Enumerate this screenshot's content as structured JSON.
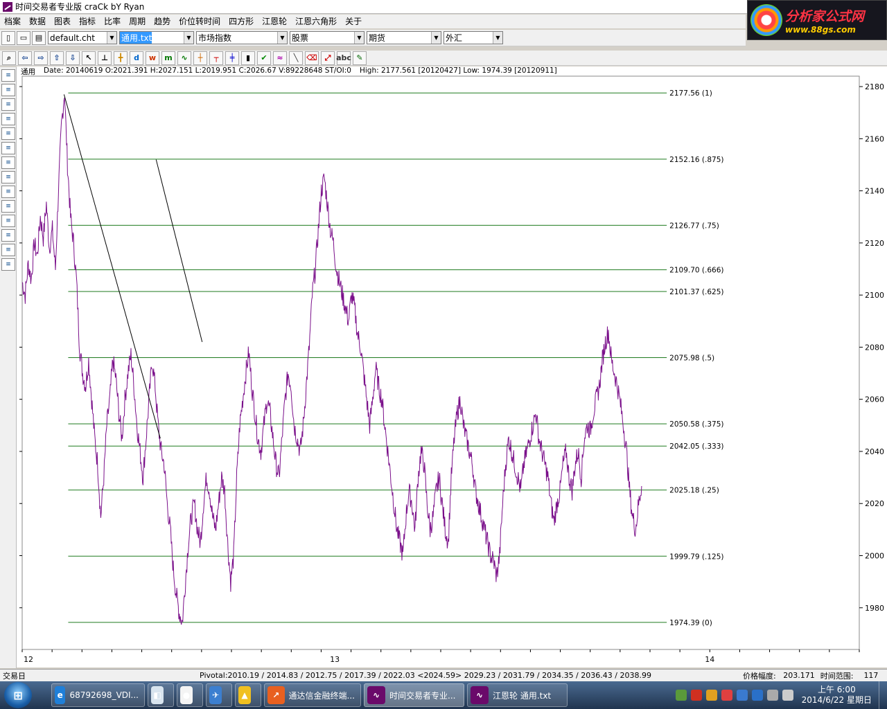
{
  "window": {
    "title": "时间交易者专业版 craCk bY Ryan"
  },
  "ad": {
    "main": "分析家公式网",
    "url": "www.88gs.com"
  },
  "menu": [
    "档案",
    "数据",
    "图表",
    "指标",
    "比率",
    "周期",
    "趋势",
    "价位转时间",
    "四方形",
    "江恩轮",
    "江恩六角形",
    "关于"
  ],
  "toolbar": {
    "combos": [
      {
        "value": "default.cht",
        "w": 100,
        "selected": false
      },
      {
        "value": "通用.txt",
        "w": 108,
        "selected": true
      },
      {
        "value": "市场指数",
        "w": 132,
        "selected": false
      },
      {
        "value": "股票",
        "w": 108,
        "selected": false
      },
      {
        "value": "期货",
        "w": 108,
        "selected": false
      },
      {
        "value": "外汇",
        "w": 86,
        "selected": false
      }
    ]
  },
  "info": {
    "symbol": "通用",
    "ohlc": "Date: 20140619 O:2021.391  H:2027.151  L:2019.951  C:2026.67  V:89228648 ST/OI:0",
    "range": "High: 2177.561 [20120427]  Low: 1974.39 [20120911]"
  },
  "chart_data": {
    "type": "line",
    "y_axis_ticks": [
      1980,
      2000,
      2020,
      2040,
      2060,
      2080,
      2100,
      2120,
      2140,
      2160,
      2180
    ],
    "ylim": [
      1964,
      2184
    ],
    "x_labels": [
      {
        "label": "12",
        "pos": 0.0
      },
      {
        "label": "13",
        "pos": 0.366
      },
      {
        "label": "14",
        "pos": 0.814
      }
    ],
    "fib_levels": [
      {
        "value": 2177.56,
        "label": "2177.56  (1)"
      },
      {
        "value": 2152.16,
        "label": "2152.16  (.875)"
      },
      {
        "value": 2126.77,
        "label": "2126.77  (.75)"
      },
      {
        "value": 2109.7,
        "label": "2109.70  (.666)"
      },
      {
        "value": 2101.37,
        "label": "2101.37  (.625)"
      },
      {
        "value": 2075.98,
        "label": "2075.98  (.5)"
      },
      {
        "value": 2050.58,
        "label": "2050.58  (.375)"
      },
      {
        "value": 2042.05,
        "label": "2042.05  (.333)"
      },
      {
        "value": 2025.18,
        "label": "2025.18  (.25)"
      },
      {
        "value": 1999.79,
        "label": "1999.79  (.125)"
      },
      {
        "value": 1974.39,
        "label": "1974.39  (0)"
      }
    ],
    "series": [
      {
        "values": [
          2105,
          2100,
          2112,
          2106,
          2120,
          2115,
          2130,
          2122,
          2135,
          2118,
          2125,
          2110,
          2140,
          2165,
          2178,
          2150,
          2130,
          2120,
          2105,
          2080,
          2070,
          2065,
          2075,
          2060,
          2045,
          2035,
          2015,
          2030,
          2050,
          2060,
          2075,
          2068,
          2055,
          2045,
          2060,
          2070,
          2077,
          2065,
          2050,
          2040,
          2030,
          2045,
          2060,
          2075,
          2065,
          2050,
          2040,
          2035,
          2020,
          2010,
          1995,
          1985,
          1978,
          1974.4,
          1990,
          2005,
          2015,
          2020,
          2010,
          2005,
          2020,
          2030,
          2025,
          2015,
          2010,
          2020,
          2030,
          2025,
          2005,
          1990,
          2000,
          2030,
          2050,
          2060,
          2070,
          2078,
          2065,
          2055,
          2045,
          2040,
          2050,
          2060,
          2055,
          2045,
          2035,
          2030,
          2045,
          2060,
          2070,
          2065,
          2050,
          2045,
          2040,
          2050,
          2065,
          2080,
          2100,
          2110,
          2125,
          2140,
          2145,
          2135,
          2125,
          2120,
          2110,
          2105,
          2100,
          2095,
          2090,
          2100,
          2095,
          2085,
          2080,
          2070,
          2060,
          2050,
          2060,
          2072,
          2065,
          2060,
          2050,
          2040,
          2030,
          2020,
          2010,
          2005,
          2000,
          2015,
          2025,
          2020,
          2010,
          2030,
          2040,
          2035,
          2020,
          2010,
          2015,
          2025,
          2030,
          2020,
          2010,
          2005,
          2030,
          2045,
          2055,
          2060,
          2050,
          2045,
          2040,
          2035,
          2025,
          2020,
          2015,
          2010,
          2005,
          2000,
          1998,
          1992,
          2000,
          2020,
          2035,
          2045,
          2040,
          2035,
          2030,
          2025,
          2035,
          2040,
          2045,
          2050,
          2055,
          2045,
          2040,
          2035,
          2030,
          2020,
          2013,
          2020,
          2025,
          2035,
          2040,
          2030,
          2025,
          2035,
          2040,
          2030,
          2045,
          2050,
          2048,
          2055,
          2060,
          2065,
          2075,
          2082,
          2086,
          2075,
          2070,
          2065,
          2058,
          2050,
          2040,
          2025,
          2015,
          2010,
          2020,
          2026.7
        ]
      }
    ],
    "trendlines": [
      {
        "x1": 0.05,
        "y1": 2177,
        "x2": 0.165,
        "y2": 2045
      },
      {
        "x1": 0.16,
        "y1": 2152,
        "x2": 0.215,
        "y2": 2082
      }
    ]
  },
  "status": {
    "left": "交易日",
    "pivot": "Pivotal:2010.19 / 2014.83 / 2012.75 / 2017.39 / 2022.03 <2024.59> 2029.23 / 2031.79 / 2034.35 / 2036.43 / 2038.99",
    "price_range_label": "价格幅度:",
    "price_range_value": "203.171",
    "time_range_label": "时间范围:",
    "time_range_value": "117"
  },
  "taskbar": {
    "tasks": [
      {
        "label": "68792698_VDI...",
        "w": 135,
        "color": "#1f7fd8",
        "glyph": "e"
      },
      {
        "label": "",
        "w": 38,
        "color": "#d8e4ee",
        "glyph": "◧"
      },
      {
        "label": "",
        "w": 38,
        "color": "#f4f4f4",
        "glyph": "●"
      },
      {
        "label": "",
        "w": 38,
        "color": "#3c7fd0",
        "glyph": "✈"
      },
      {
        "label": "",
        "w": 38,
        "color": "#f0c020",
        "glyph": "▲"
      },
      {
        "label": "通达信金融终端...",
        "w": 140,
        "color": "#e86020",
        "glyph": "↗"
      },
      {
        "label": "时间交易者专业...",
        "w": 145,
        "color": "#6a0a6a",
        "glyph": "∿",
        "active": true
      },
      {
        "label": "江恩轮  通用.txt",
        "w": 145,
        "color": "#6a0a6a",
        "glyph": "∿"
      }
    ],
    "clock_time": "上午 6:00",
    "clock_date": "2014/6/22 星期日"
  }
}
